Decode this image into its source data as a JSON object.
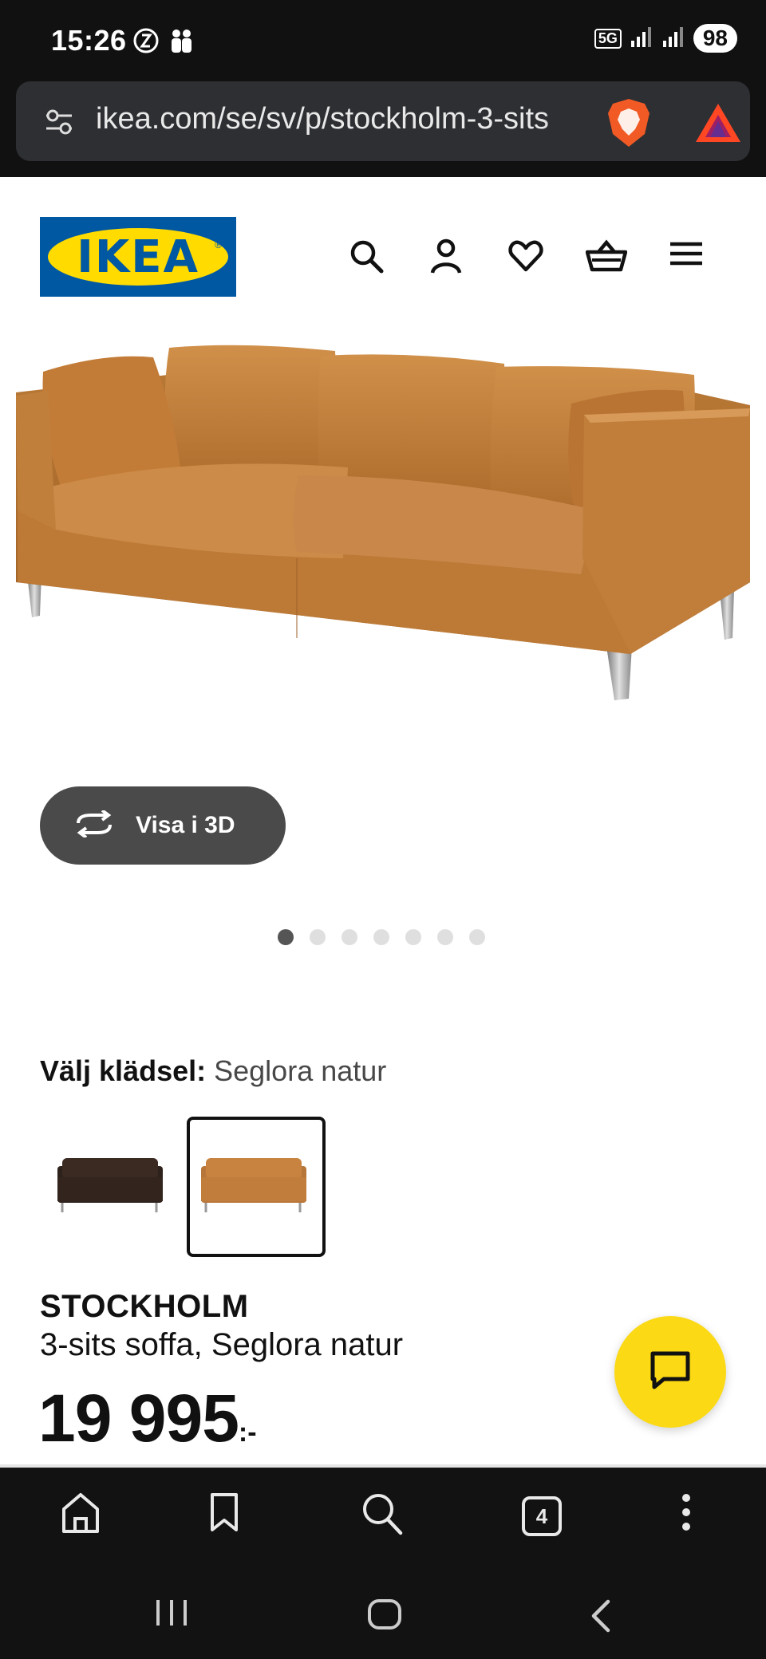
{
  "status_bar": {
    "time": "15:26",
    "network": "5G",
    "battery": "98"
  },
  "browser": {
    "url": "ikea.com/se/sv/p/stockholm-3-sits",
    "tab_count": "4"
  },
  "header": {
    "logo_text": "IKEA",
    "icons": [
      "search-icon",
      "account-icon",
      "heart-icon",
      "basket-icon",
      "menu-icon"
    ]
  },
  "gallery": {
    "view_3d_label": "Visa i 3D",
    "dot_count": 7,
    "active_dot": 0
  },
  "fabric": {
    "label": "Välj klädsel:",
    "value": "Seglora natur",
    "options": [
      {
        "name": "dark brown",
        "color": "#3a2a22",
        "selected": false
      },
      {
        "name": "Seglora natur",
        "color": "#c7833f",
        "selected": true
      }
    ]
  },
  "product": {
    "name": "STOCKHOLM",
    "description": "3-sits soffa, Seglora natur",
    "price": "19 995",
    "price_suffix": ":-"
  },
  "colors": {
    "ikea_blue": "#0058a3",
    "ikea_yellow": "#ffdb00",
    "chat_fab": "#fbd914",
    "leather": "#c7833f"
  }
}
